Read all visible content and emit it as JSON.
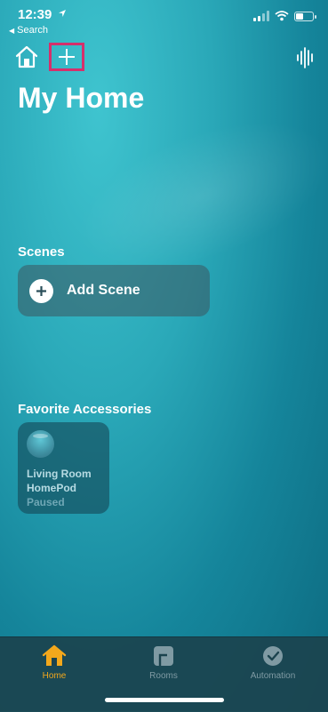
{
  "status_bar": {
    "time": "12:39",
    "back_label": "Search"
  },
  "page": {
    "title": "My Home"
  },
  "scenes": {
    "section_title": "Scenes",
    "add_label": "Add Scene"
  },
  "favorites": {
    "section_title": "Favorite Accessories",
    "items": [
      {
        "name_line1": "Living Room",
        "name_line2": "HomePod",
        "status": "Paused",
        "icon": "homepod-icon"
      }
    ]
  },
  "tabs": [
    {
      "label": "Home",
      "icon": "house-icon",
      "active": true
    },
    {
      "label": "Rooms",
      "icon": "rooms-icon",
      "active": false
    },
    {
      "label": "Automation",
      "icon": "clock-check-icon",
      "active": false
    }
  ],
  "colors": {
    "accent": "#f3a81c",
    "highlight_box": "#d62f6b",
    "inactive_tab": "#7f9aa3"
  }
}
